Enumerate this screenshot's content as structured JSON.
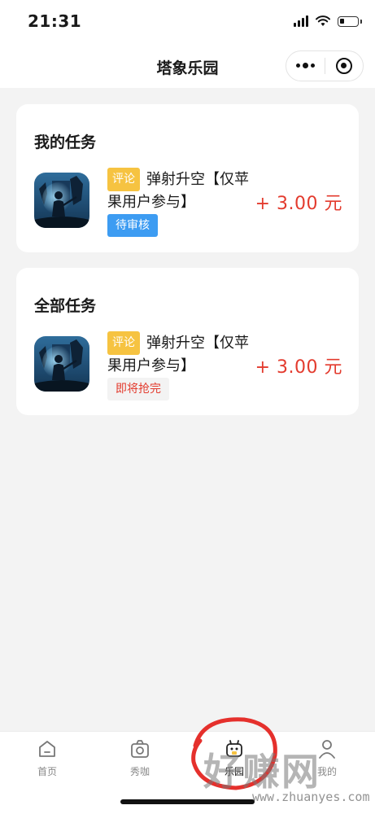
{
  "status_bar": {
    "time": "21:31"
  },
  "nav": {
    "title": "塔象乐园"
  },
  "my_tasks": {
    "title": "我的任务",
    "task": {
      "type_tag": "评论",
      "title": "弹射升空【仅苹果用户参与】",
      "status": "待审核",
      "reward": "+ 3.00 元"
    }
  },
  "all_tasks": {
    "title": "全部任务",
    "task": {
      "type_tag": "评论",
      "title": "弹射升空【仅苹果用户参与】",
      "status": "即将抢完",
      "reward": "+ 3.00 元"
    }
  },
  "tab_bar": {
    "items": [
      {
        "label": "首页",
        "icon": "home-icon"
      },
      {
        "label": "秀咖",
        "icon": "camera-icon"
      },
      {
        "label": "乐园",
        "icon": "robot-icon"
      },
      {
        "label": "我的",
        "icon": "profile-icon"
      }
    ]
  },
  "watermark": {
    "text": "好赚网",
    "url": "www.zhuanyes.com"
  },
  "colors": {
    "accent_red": "#e33b2e",
    "pending_blue": "#3d9cf2",
    "tag_yellow": "#f6c341",
    "watermark_circle": "#e5302c"
  }
}
